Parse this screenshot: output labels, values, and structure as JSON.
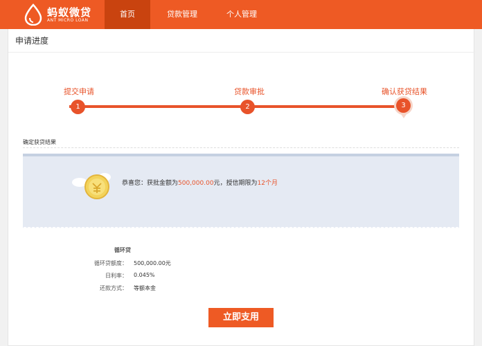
{
  "brand": {
    "name_cn": "蚂蚁微贷",
    "name_en": "ANT MICRO LOAN",
    "accent": "#ee5a24"
  },
  "nav": {
    "items": [
      {
        "label": "首页",
        "active": true
      },
      {
        "label": "贷款管理",
        "active": false
      },
      {
        "label": "个人管理",
        "active": false
      }
    ]
  },
  "page": {
    "title": "申请进度"
  },
  "progress": {
    "steps": [
      {
        "number": "1",
        "label": "提交申请"
      },
      {
        "number": "2",
        "label": "贷款审批"
      },
      {
        "number": "3",
        "label": "确认获贷结果"
      }
    ],
    "current_step": 3
  },
  "result": {
    "section_title": "确定获贷结果",
    "message_prefix": "恭喜您：获批金额为",
    "amount": "500,000.00",
    "message_mid": "元，授信期限为",
    "term": "12个月",
    "icon": "coin-icon"
  },
  "details": {
    "title": "循环贷",
    "rows": [
      {
        "label": "循环贷额度：",
        "value": "500,000.00元"
      },
      {
        "label": "日利率：",
        "value": "0.045%"
      },
      {
        "label": "还款方式：",
        "value": "等额本金"
      }
    ]
  },
  "actions": {
    "primary": "立即支用"
  }
}
